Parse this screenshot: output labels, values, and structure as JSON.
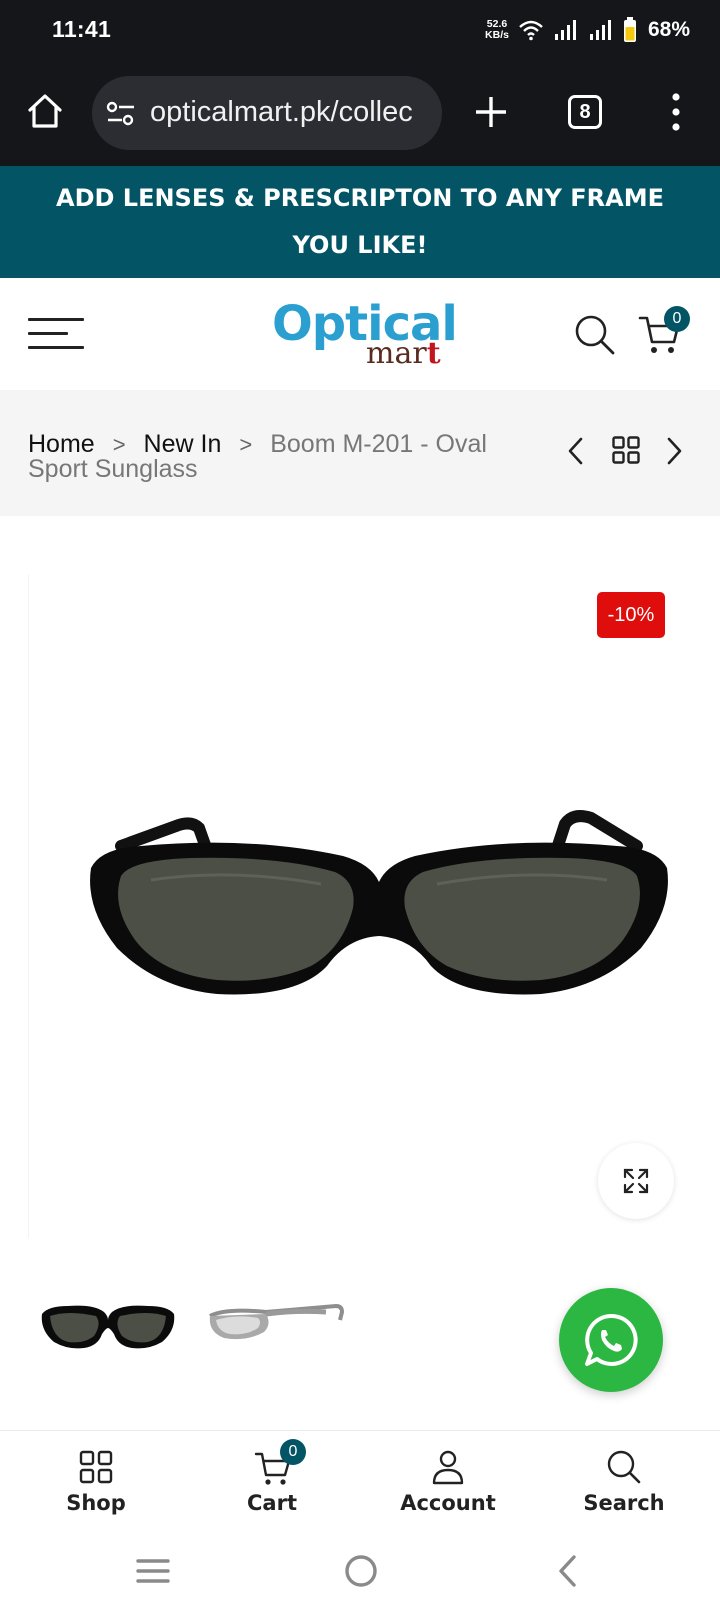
{
  "status_bar": {
    "time": "11:41",
    "net_speed_value": "52.6",
    "net_speed_unit": "KB/s",
    "battery": "68%"
  },
  "browser": {
    "url": "opticalmart.pk/collec",
    "tab_count": "8"
  },
  "announcement": {
    "text": "ADD LENSES & PRESCRIPTON TO ANY FRAME YOU LIKE!"
  },
  "header": {
    "logo_top": "Optical",
    "logo_bottom_main": "mar",
    "logo_bottom_accent": "t",
    "cart_count": "0"
  },
  "breadcrumb": {
    "home": "Home",
    "section": "New In",
    "current": "Boom M-201 - Oval Sport Sunglass"
  },
  "product": {
    "discount_badge": "-10%"
  },
  "bottom_nav": {
    "shop": "Shop",
    "cart": "Cart",
    "cart_count": "0",
    "account": "Account",
    "search": "Search"
  },
  "colors": {
    "status_bg": "#151619",
    "announcement_bg": "#035566",
    "sale_badge": "#e00d0d",
    "whatsapp": "#2cb742",
    "logo_blue": "#2a9fd0",
    "logo_accent": "#c2161e"
  }
}
